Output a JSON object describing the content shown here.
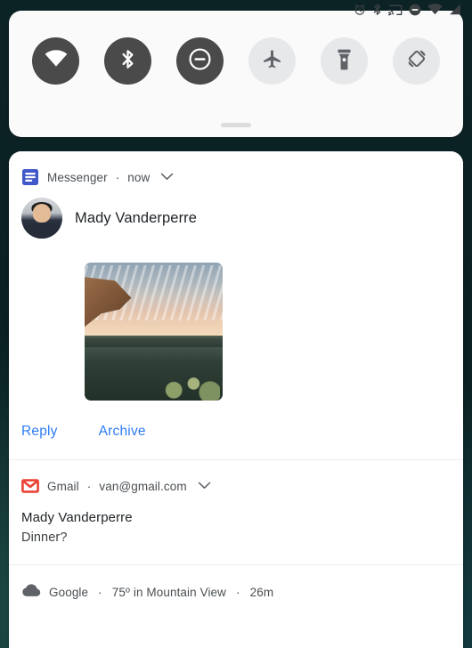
{
  "status_bar": {
    "icons": [
      {
        "name": "alarm-icon",
        "label": "alarm"
      },
      {
        "name": "bluetooth-icon",
        "label": "bluetooth"
      },
      {
        "name": "cast-icon",
        "label": "cast"
      },
      {
        "name": "do-not-disturb-icon",
        "label": "do not disturb"
      },
      {
        "name": "wifi-icon",
        "label": "wifi"
      },
      {
        "name": "cellular-signal-icon",
        "label": "signal"
      }
    ]
  },
  "quick_settings": {
    "tiles": [
      {
        "name": "wifi-tile",
        "label": "Wi-Fi",
        "state": "on"
      },
      {
        "name": "bluetooth-tile",
        "label": "Bluetooth",
        "state": "on"
      },
      {
        "name": "do-not-disturb-tile",
        "label": "Do Not Disturb",
        "state": "on"
      },
      {
        "name": "airplane-mode-tile",
        "label": "Airplane mode",
        "state": "off"
      },
      {
        "name": "flashlight-tile",
        "label": "Flashlight",
        "state": "off"
      },
      {
        "name": "auto-rotate-tile",
        "label": "Auto-rotate",
        "state": "off"
      }
    ],
    "handle_label": "Expand quick settings"
  },
  "notifications": {
    "messenger": {
      "app_name": "Messenger",
      "separator": "·",
      "time": "now",
      "sender": "Mady Vanderperre",
      "photo_alt": "sunset landscape photo",
      "actions": [
        {
          "name": "reply-button",
          "label": "Reply"
        },
        {
          "name": "archive-button",
          "label": "Archive"
        }
      ]
    },
    "gmail": {
      "app_name": "Gmail",
      "separator": "·",
      "account": "van@gmail.com",
      "title": "Mady Vanderperre",
      "body": "Dinner?"
    },
    "weather": {
      "app_name": "Google",
      "separator_one": "·",
      "condition": "75º in Mountain View",
      "separator_two": "·",
      "time": "26m"
    }
  },
  "colors": {
    "accent_blue": "#2e7cf6",
    "messenger_blue": "#4258c9",
    "gmail_red": "#ea4335",
    "tile_on": "#4a4a4a",
    "tile_off": "#e6e8e9",
    "panel_bg": "#ffffff",
    "wallpaper": "#0b2326"
  }
}
